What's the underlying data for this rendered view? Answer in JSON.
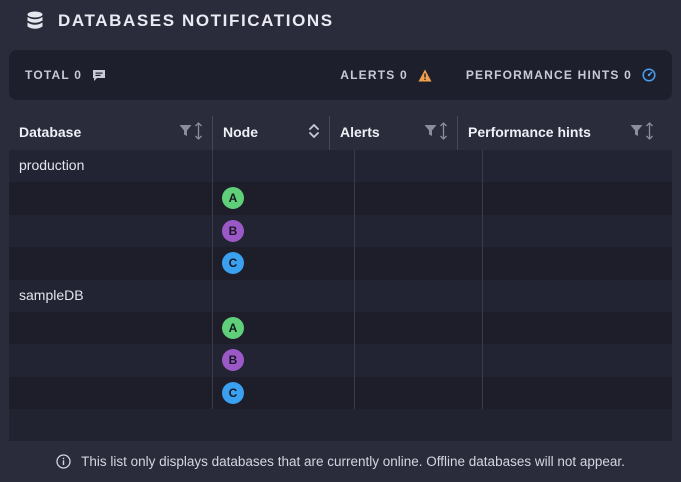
{
  "header": {
    "title": "DATABASES NOTIFICATIONS",
    "icon": "database-icon"
  },
  "summary": {
    "total_label": "TOTAL 0",
    "alerts_label": "ALERTS 0",
    "hints_label": "PERFORMANCE HINTS 0"
  },
  "table": {
    "columns": [
      {
        "label": "Database"
      },
      {
        "label": "Node"
      },
      {
        "label": "Alerts"
      },
      {
        "label": "Performance hints"
      }
    ],
    "groups": [
      {
        "database": "production",
        "nodes": [
          "A",
          "B",
          "C"
        ]
      },
      {
        "database": "sampleDB",
        "nodes": [
          "A",
          "B",
          "C"
        ]
      }
    ]
  },
  "colors": {
    "node_a": "#5fcf7a",
    "node_b": "#9b59c8",
    "node_c": "#3aa0f0",
    "warning": "#f0a04b",
    "hint": "#4a9ff0"
  },
  "footer": {
    "text": "This list only displays databases that are currently online. Offline databases will not appear."
  }
}
